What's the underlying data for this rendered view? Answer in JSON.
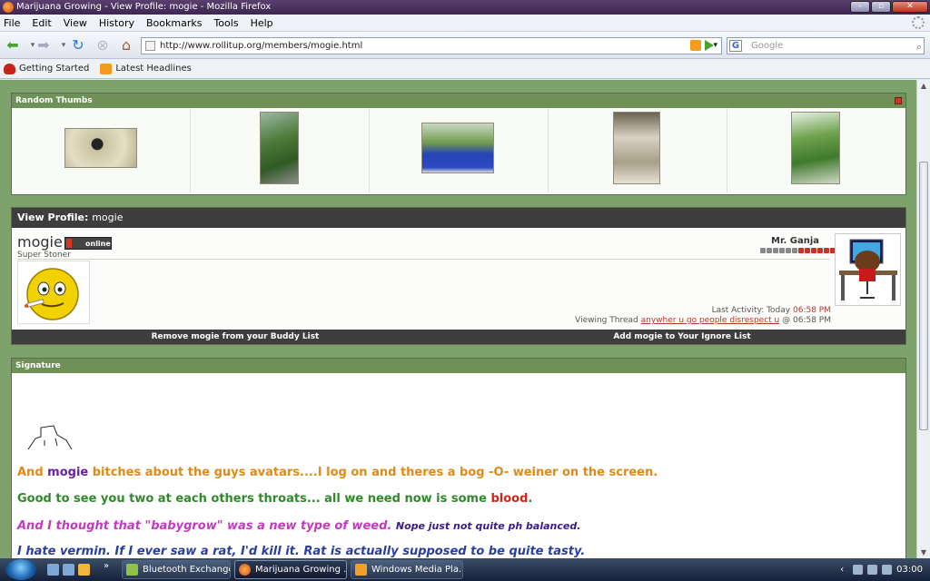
{
  "window": {
    "title": "Marijuana Growing - View Profile: mogie - Mozilla Firefox"
  },
  "menu": [
    "File",
    "Edit",
    "View",
    "History",
    "Bookmarks",
    "Tools",
    "Help"
  ],
  "nav": {
    "url": "http://www.rollitup.org/members/mogie.html",
    "search_placeholder": "Google"
  },
  "bookmarks": [
    "Getting Started",
    "Latest Headlines"
  ],
  "thumbs": {
    "title": "Random Thumbs"
  },
  "profile": {
    "heading": "View Profile:",
    "username": "mogie",
    "status": "online",
    "user_title": "Super Stoner",
    "rank": "Mr. Ganja",
    "reputation_fraction": 0.5,
    "last_activity_label": "Last Activity: Today",
    "last_activity_time": "06:58 PM",
    "viewing_label": "Viewing Thread",
    "viewing_thread": "anywher u go people disrespect u",
    "viewing_time": "@ 06:58 PM",
    "actions": {
      "buddy": "Remove mogie from your Buddy List",
      "ignore": "Add mogie to Your Ignore List"
    }
  },
  "signature": {
    "title": "Signature",
    "line1_a": "And ",
    "line1_name": "mogie",
    "line1_b": " bitches about the guys avatars....I log on and theres a bog -O- weiner on the screen.",
    "line2_a": "Good to see you two at each others throats... all we need now is some ",
    "line2_b": "blood",
    "line2_c": ".",
    "line3_a": "And I thought that \"babygrow\" was a new type of weed.",
    "line3_b": "Nope just not quite ph balanced.",
    "line4": "I hate vermin. If I ever saw a rat, I'd kill it. Rat is actually supposed to be quite tasty."
  },
  "taskbar": {
    "tasks": [
      "Bluetooth Exchange...",
      "Marijuana Growing ...",
      "Windows Media Pla..."
    ],
    "clock": "03:00"
  }
}
